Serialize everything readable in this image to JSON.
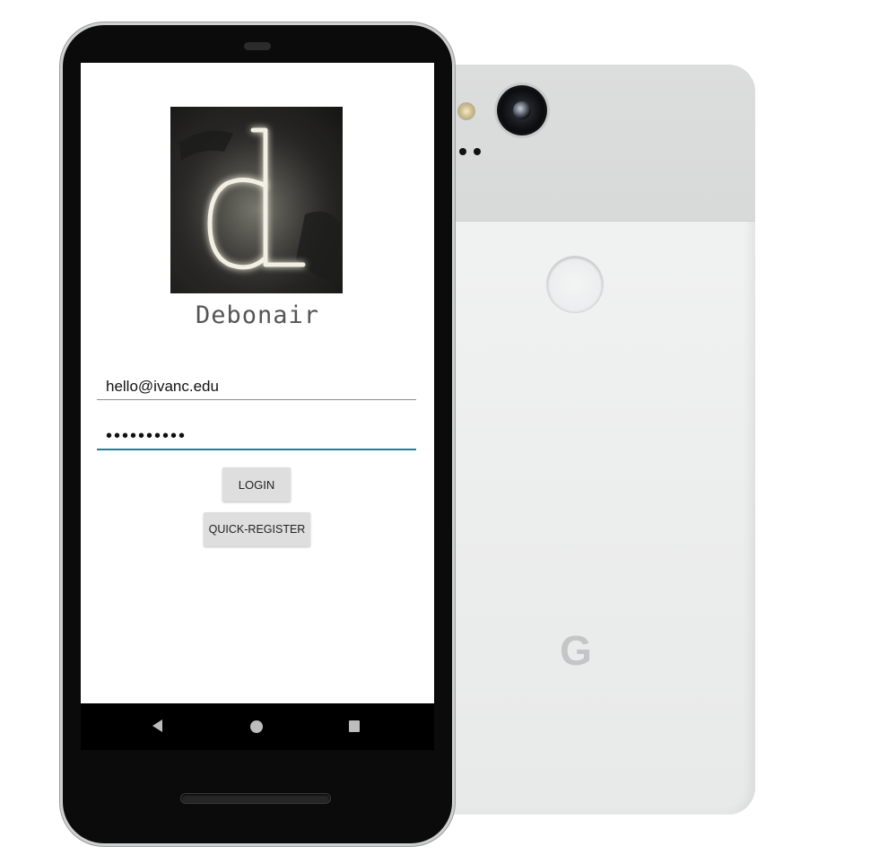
{
  "app": {
    "name": "Debonair",
    "logo_letter": "d"
  },
  "login_form": {
    "email_value": "hello@ivanc.edu",
    "password_value": "••••••••••",
    "login_label": "LOGIN",
    "register_label": "QUICK-REGISTER"
  },
  "device_back": {
    "brand_mark": "G"
  },
  "navigation": {
    "back_icon": "back-triangle-icon",
    "home_icon": "home-circle-icon",
    "recents_icon": "recents-square-icon"
  },
  "colors": {
    "accent_underline": "#1d7fa7",
    "button_bg": "#dedede",
    "navbar_bg": "#000000"
  }
}
